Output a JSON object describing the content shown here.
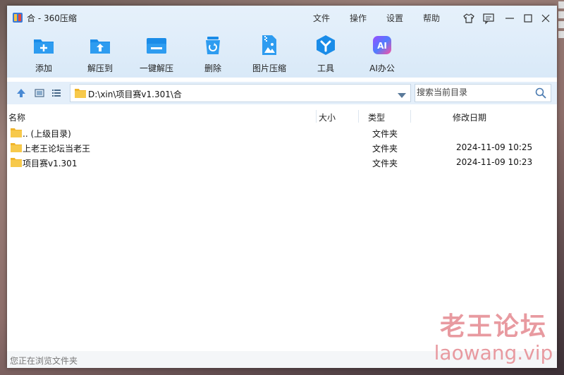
{
  "window": {
    "title": "合 - 360压缩"
  },
  "menu": [
    "文件",
    "操作",
    "设置",
    "帮助"
  ],
  "toolbar": [
    {
      "label": "添加",
      "icon": "add-icon"
    },
    {
      "label": "解压到",
      "icon": "extract-to-icon"
    },
    {
      "label": "一键解压",
      "icon": "one-click-extract-icon"
    },
    {
      "label": "删除",
      "icon": "delete-icon"
    },
    {
      "label": "图片压缩",
      "icon": "image-compress-icon"
    },
    {
      "label": "工具",
      "icon": "tools-icon"
    },
    {
      "label": "AI办公",
      "icon": "ai-office-icon",
      "icon_text": "AI"
    }
  ],
  "address": {
    "path": "D:\\xin\\项目赛v1.301\\合"
  },
  "search": {
    "placeholder": "搜索当前目录"
  },
  "columns": {
    "name": "名称",
    "size": "大小",
    "type": "类型",
    "date": "修改日期"
  },
  "files": [
    {
      "name": ".. (上级目录)",
      "type": "文件夹",
      "date": ""
    },
    {
      "name": "上老王论坛当老王",
      "type": "文件夹",
      "date": "2024-11-09 10:25"
    },
    {
      "name": "项目赛v1.301",
      "type": "文件夹",
      "date": "2024-11-09 10:23"
    }
  ],
  "status": {
    "text": "您正在浏览文件夹"
  },
  "watermark": {
    "line1": "老王论坛",
    "line2": "laowang.vip"
  },
  "colors": {
    "accent": "#1a8ce8",
    "toolbar_bg": "#dceaf8",
    "folder": "#f5c344",
    "ai_gradient": [
      "#9b4dff",
      "#ff4fa0"
    ],
    "watermark": "#e89aa0"
  }
}
